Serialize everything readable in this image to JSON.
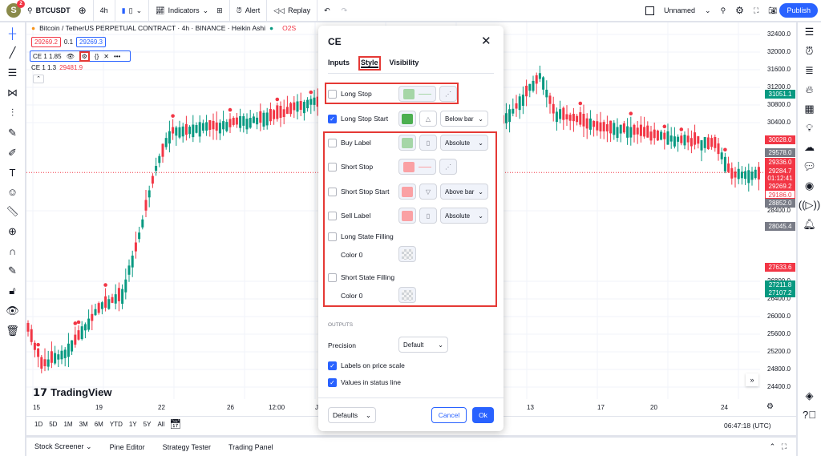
{
  "topbar": {
    "avatar_letter": "S",
    "notifications": "2",
    "symbol": "BTCUSDT",
    "interval": "4h",
    "indicators": "Indicators",
    "alert": "Alert",
    "replay": "Replay",
    "layout_name": "Unnamed",
    "publish": "Publish"
  },
  "legend": {
    "title": "Bitcoin / TetherUS PERPETUAL CONTRACT · 4h · BINANCE · Heikin Ashi",
    "ohlc_prefix": "O2S",
    "bid": "29269.2",
    "spread": "0.1",
    "ask": "29269.3",
    "ind1": "CE 1 1.85",
    "ind2": "CE 1 1.3",
    "ind2_value": "29481.9"
  },
  "price_axis": {
    "ticks": [
      "32400.0",
      "32000.0",
      "31600.0",
      "31200.0",
      "30800.0",
      "30400.0",
      "28400.0",
      "26800.0",
      "26400.0",
      "26000.0",
      "25600.0",
      "25200.0",
      "24800.0",
      "24400.0"
    ],
    "labels": [
      {
        "text": "31051.1",
        "color": "#089981"
      },
      {
        "text": "30028.0",
        "color": "#f23645"
      },
      {
        "text": "29578.0",
        "color": "#787b86"
      },
      {
        "text": "29336.0",
        "color": "#f23645"
      },
      {
        "text": "29284.7",
        "color": "#f23645"
      },
      {
        "text": "01:12:41",
        "color": "#f23645"
      },
      {
        "text": "29269.2",
        "color": "#f23645"
      },
      {
        "text": "29186.0",
        "color": "#ffffff"
      },
      {
        "text": "28852.0",
        "color": "#787b86"
      },
      {
        "text": "28045.4",
        "color": "#787b86"
      },
      {
        "text": "27633.6",
        "color": "#f23645"
      },
      {
        "text": "27211.8",
        "color": "#089981"
      },
      {
        "text": "27107.2",
        "color": "#089981"
      }
    ]
  },
  "time_axis": [
    "15",
    "19",
    "22",
    "26",
    "12:00",
    "J",
    "13",
    "17",
    "20",
    "24"
  ],
  "watermark": "TradingView",
  "ranges": [
    "1D",
    "5D",
    "1M",
    "3M",
    "6M",
    "YTD",
    "1Y",
    "5Y",
    "All"
  ],
  "clock": "06:47:18 (UTC)",
  "bottom_tabs": [
    "Stock Screener",
    "Pine Editor",
    "Strategy Tester",
    "Trading Panel"
  ],
  "dialog": {
    "title": "CE",
    "tabs": [
      "Inputs",
      "Style",
      "Visibility"
    ],
    "active_tab": "Style",
    "rows": [
      {
        "label": "Long Stop",
        "checked": false,
        "color": "#a5d6a7"
      },
      {
        "label": "Long Stop Start",
        "checked": true,
        "color": "#4caf50",
        "select": "Below bar"
      },
      {
        "label": "Buy Label",
        "checked": false,
        "color": "#a5d6a7",
        "select": "Absolute"
      },
      {
        "label": "Short Stop",
        "checked": false,
        "color": "#faa1a4"
      },
      {
        "label": "Short Stop Start",
        "checked": false,
        "color": "#faa1a4",
        "select": "Above bar"
      },
      {
        "label": "Sell Label",
        "checked": false,
        "color": "#faa1a4",
        "select": "Absolute"
      },
      {
        "label": "Long State Filling",
        "checked": false
      },
      {
        "label": "Color 0"
      },
      {
        "label": "Short State Filling",
        "checked": false
      },
      {
        "label": "Color 0"
      }
    ],
    "outputs": "OUTPUTS",
    "precision_label": "Precision",
    "precision_value": "Default",
    "labels_on_scale": "Labels on price scale",
    "values_in_status": "Values in status line",
    "defaults": "Defaults",
    "cancel": "Cancel",
    "ok": "Ok"
  },
  "colors": {
    "up": "#089981",
    "down": "#f23645",
    "accent": "#2962ff",
    "highlight": "#e53935"
  }
}
